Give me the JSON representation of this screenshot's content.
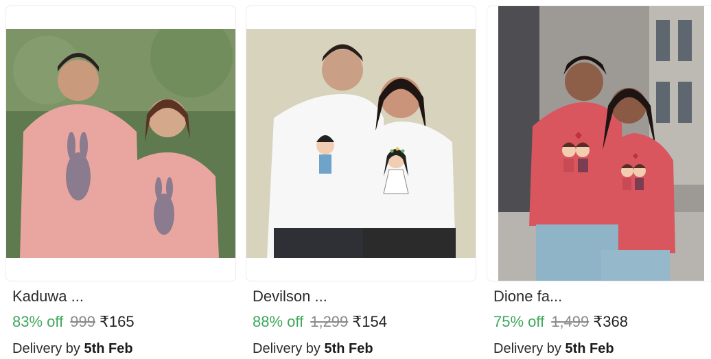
{
  "products": [
    {
      "title": "Kaduwa ...",
      "discount": "83% off",
      "mrp": "999",
      "price": "₹165",
      "delivery_prefix": "Delivery by",
      "delivery_date": "5th Feb",
      "image_bg": "#5f7a4f",
      "shirt_color": "#e9a6a0",
      "print_icon": "rabbit-print-icon"
    },
    {
      "title": "Devilson ...",
      "discount": "88% off",
      "mrp": "1,299",
      "price": "₹154",
      "delivery_prefix": "Delivery by",
      "delivery_date": "5th Feb",
      "image_bg": "#d8d3bd",
      "shirt_color": "#ffffff",
      "print_icon": "couple-cartoon-print-icon"
    },
    {
      "title": "Dione fa...",
      "discount": "75% off",
      "mrp": "1,499",
      "price": "₹368",
      "delivery_prefix": "Delivery by",
      "delivery_date": "5th Feb",
      "image_bg": "#9d9a96",
      "shirt_color": "#d9565f",
      "print_icon": "kissing-couple-print-icon"
    }
  ],
  "colors": {
    "discount": "#3fa85c",
    "strikethrough": "#8a8a8a",
    "text": "#2b2b2b"
  }
}
